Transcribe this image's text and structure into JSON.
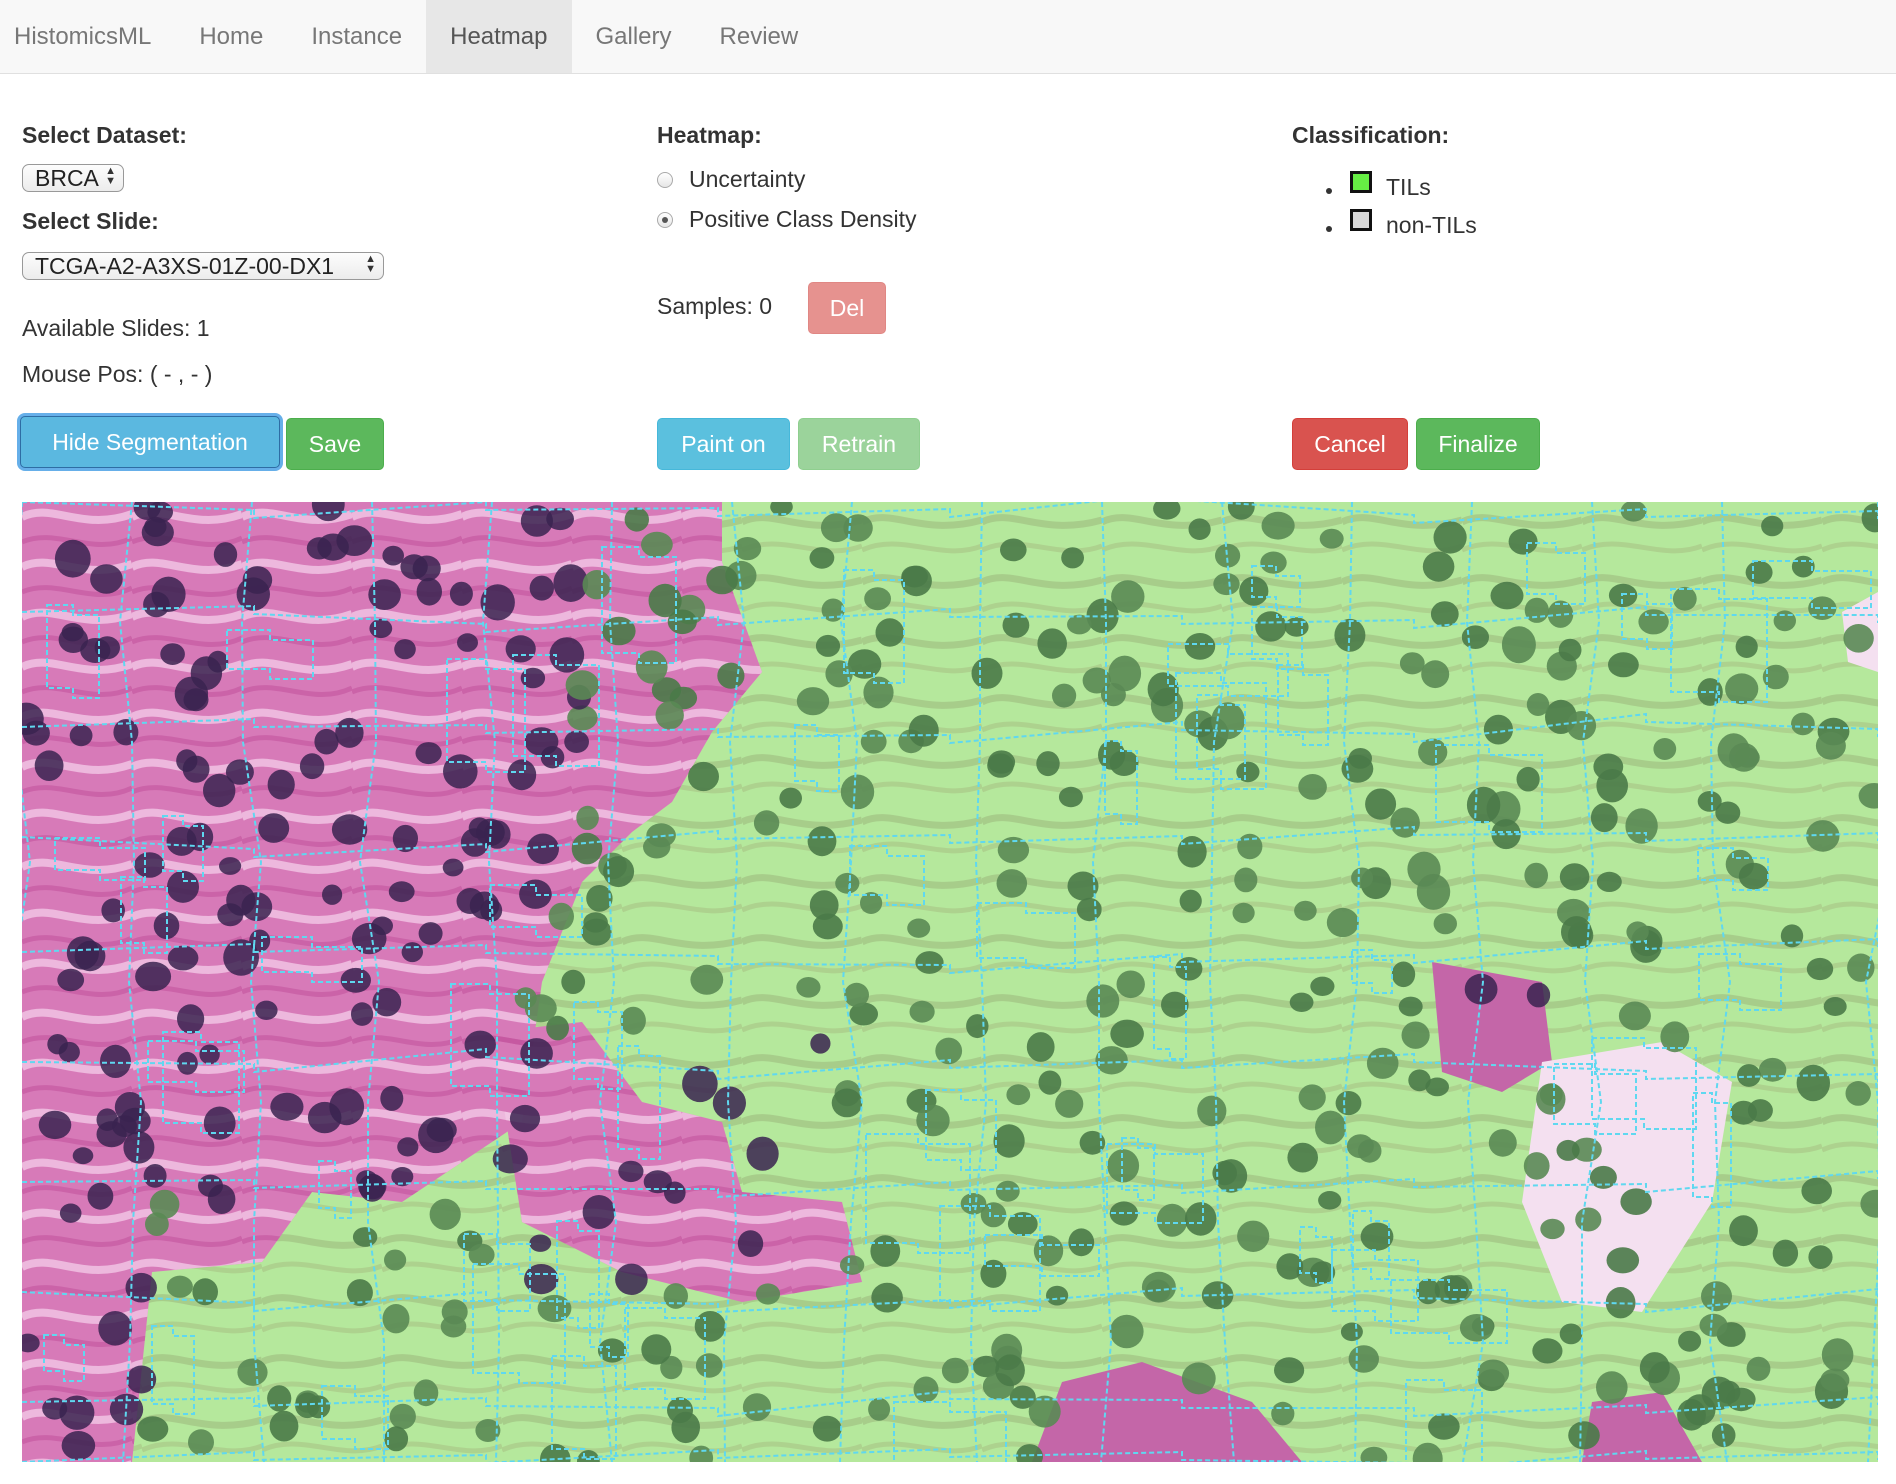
{
  "nav": {
    "brand": "HistomicsML",
    "items": [
      {
        "label": "Home",
        "active": false
      },
      {
        "label": "Instance",
        "active": false
      },
      {
        "label": "Heatmap",
        "active": true
      },
      {
        "label": "Gallery",
        "active": false
      },
      {
        "label": "Review",
        "active": false
      }
    ]
  },
  "left": {
    "dataset_label": "Select Dataset:",
    "dataset_value": "BRCA",
    "slide_label": "Select Slide:",
    "slide_value": "TCGA-A2-A3XS-01Z-00-DX1",
    "available_slides": "Available Slides: 1",
    "mouse_pos": "Mouse Pos: ( - , - )",
    "hide_segmentation_label": "Hide Segmentation",
    "save_label": "Save"
  },
  "middle": {
    "heatmap_label": "Heatmap:",
    "options": [
      {
        "label": "Uncertainty",
        "checked": false
      },
      {
        "label": "Positive Class Density",
        "checked": true
      }
    ],
    "samples": "Samples: 0",
    "del_label": "Del",
    "paint_on_label": "Paint on",
    "retrain_label": "Retrain"
  },
  "right": {
    "classification_label": "Classification:",
    "classes": [
      {
        "label": "TILs",
        "color": "#66ee44"
      },
      {
        "label": "non-TILs",
        "color": "#d9d9d9"
      }
    ],
    "cancel_label": "Cancel",
    "finalize_label": "Finalize"
  },
  "colors": {
    "overlay_green": "#b8eca0",
    "tissue_pink": "#d670b4",
    "nucleus_dark": "#3a2350",
    "nucleus_green": "#4a7a48",
    "segmentation_line": "#5fd8f0"
  }
}
